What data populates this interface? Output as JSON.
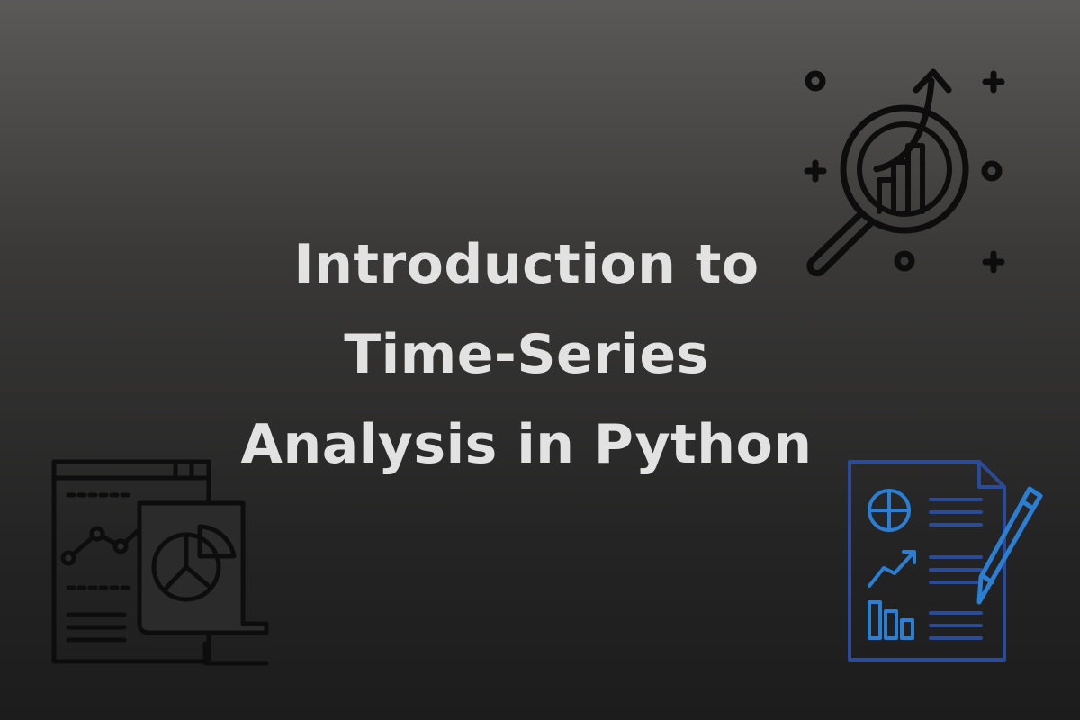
{
  "title": {
    "line1": "Introduction to",
    "line2": "Time-Series",
    "line3": "Analysis in Python"
  },
  "icons": {
    "top_right": "magnifier-growth-chart-icon",
    "bottom_left": "dashboard-charts-icon",
    "bottom_right": "report-document-pencil-icon"
  },
  "colors": {
    "title_text": "#e2e2e2",
    "background_top": "#5b5958",
    "background_bottom": "#1c1c1c",
    "icon_dark": "#0d0d0d",
    "report_blue": "#2a7fd4",
    "report_navy": "#2a4a9a"
  }
}
